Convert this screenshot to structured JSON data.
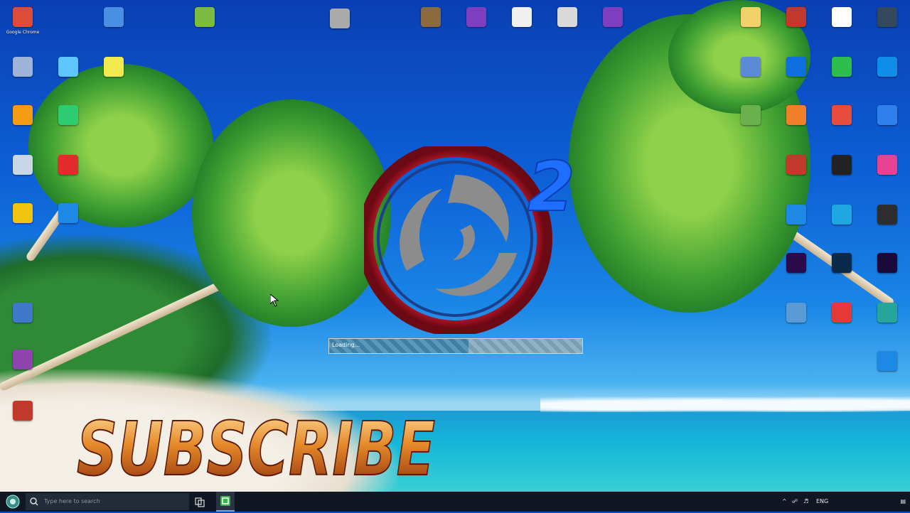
{
  "desktop": {
    "left_icons": [
      {
        "label": "Google Chrome",
        "icon": "chrome-icon",
        "color": "#dd4b39"
      },
      {
        "label": "",
        "icon": "document-icon",
        "color": "#4a90e2"
      },
      {
        "label": "",
        "icon": "file-icon",
        "color": "#7dbb3f"
      },
      {
        "label": "",
        "icon": "recycle-bin-icon",
        "color": "#9db4d8"
      },
      {
        "label": "",
        "icon": "app-icon",
        "color": "#5ec6ff"
      },
      {
        "label": "",
        "icon": "notepad-icon",
        "color": "#f2e94e"
      },
      {
        "label": "",
        "icon": "vlc-icon",
        "color": "#f39c12"
      },
      {
        "label": "",
        "icon": "app-icon",
        "color": "#2ecc71"
      },
      {
        "label": "",
        "icon": "recycle-bin-icon",
        "color": "#c9d6e8"
      },
      {
        "label": "",
        "icon": "opera-icon",
        "color": "#e32b2b"
      },
      {
        "label": "",
        "icon": "add-icon",
        "color": "#f1c40f"
      },
      {
        "label": "",
        "icon": "edge-icon",
        "color": "#1e88e5"
      },
      {
        "label": "",
        "icon": "monitor-icon",
        "color": "#3f78c8"
      },
      {
        "label": "",
        "icon": "archive-icon",
        "color": "#8e44ad"
      },
      {
        "label": "",
        "icon": "app-icon",
        "color": "#c0392b"
      }
    ],
    "top_icons": [
      {
        "label": "",
        "icon": "drive-icon",
        "color": "#aaaaaa"
      },
      {
        "label": "",
        "icon": "photo-icon",
        "color": "#8b6b3d"
      },
      {
        "label": "",
        "icon": "archive-icon",
        "color": "#7d3fbf"
      },
      {
        "label": "",
        "icon": "game-icon",
        "color": "#f0f0f0"
      },
      {
        "label": "",
        "icon": "game-icon",
        "color": "#d9d9d9"
      },
      {
        "label": "",
        "icon": "archive-icon",
        "color": "#7d3fbf"
      }
    ],
    "right_icons": [
      {
        "label": "",
        "icon": "folder-icon",
        "color": "#f2d16b"
      },
      {
        "label": "",
        "icon": "app-icon",
        "color": "#c0392b"
      },
      {
        "label": "",
        "icon": "document-icon",
        "color": "#ffffff"
      },
      {
        "label": "",
        "icon": "app-icon",
        "color": "#34495e"
      },
      {
        "label": "",
        "icon": "app-icon",
        "color": "#5b8ad6"
      },
      {
        "label": "",
        "icon": "dropbox-icon",
        "color": "#0f6fe0"
      },
      {
        "label": "",
        "icon": "app-icon",
        "color": "#2dbe4e"
      },
      {
        "label": "",
        "icon": "teamviewer-icon",
        "color": "#0e8ee9"
      },
      {
        "label": "",
        "icon": "bluestacks-icon",
        "color": "#6ab04c"
      },
      {
        "label": "",
        "icon": "app-icon",
        "color": "#f07f2a"
      },
      {
        "label": "",
        "icon": "app-icon",
        "color": "#e74c3c"
      },
      {
        "label": "",
        "icon": "app-icon",
        "color": "#2f80ed"
      },
      {
        "label": "",
        "icon": "app-icon",
        "color": "#c0392b"
      },
      {
        "label": "",
        "icon": "camera-icon",
        "color": "#222222"
      },
      {
        "label": "",
        "icon": "app-icon",
        "color": "#e84393"
      },
      {
        "label": "",
        "icon": "app-icon",
        "color": "#1e88e5"
      },
      {
        "label": "",
        "icon": "app-icon",
        "color": "#1ea7e1"
      },
      {
        "label": "",
        "icon": "app-icon",
        "color": "#2d2d2d"
      },
      {
        "label": "",
        "icon": "premiere-icon",
        "color": "#2a0a4a"
      },
      {
        "label": "",
        "icon": "photoshop-icon",
        "color": "#0b2a4a"
      },
      {
        "label": "",
        "icon": "after-effects-icon",
        "color": "#1a0a3a"
      },
      {
        "label": "",
        "icon": "app-icon",
        "color": "#5b9bd5"
      },
      {
        "label": "",
        "icon": "record-icon",
        "color": "#e53935"
      },
      {
        "label": "",
        "icon": "app-icon",
        "color": "#26a69a"
      },
      {
        "label": "",
        "icon": "chat-icon",
        "color": "#1e88e5"
      }
    ]
  },
  "splash": {
    "logo_text": "2",
    "status_text": "Loading...",
    "version_text": "",
    "progress": 0.55,
    "ring_color": "#c0172a",
    "swirl_color": "#8c8c8c",
    "digit_color": "#1e6fff"
  },
  "overlay": {
    "subscribe_text": "SUBSCRIBE",
    "fire_color": "#d3731f"
  },
  "taskbar": {
    "search_placeholder": "Type here to search",
    "clock_time": "",
    "clock_date": "",
    "tray_language": "ENG"
  }
}
